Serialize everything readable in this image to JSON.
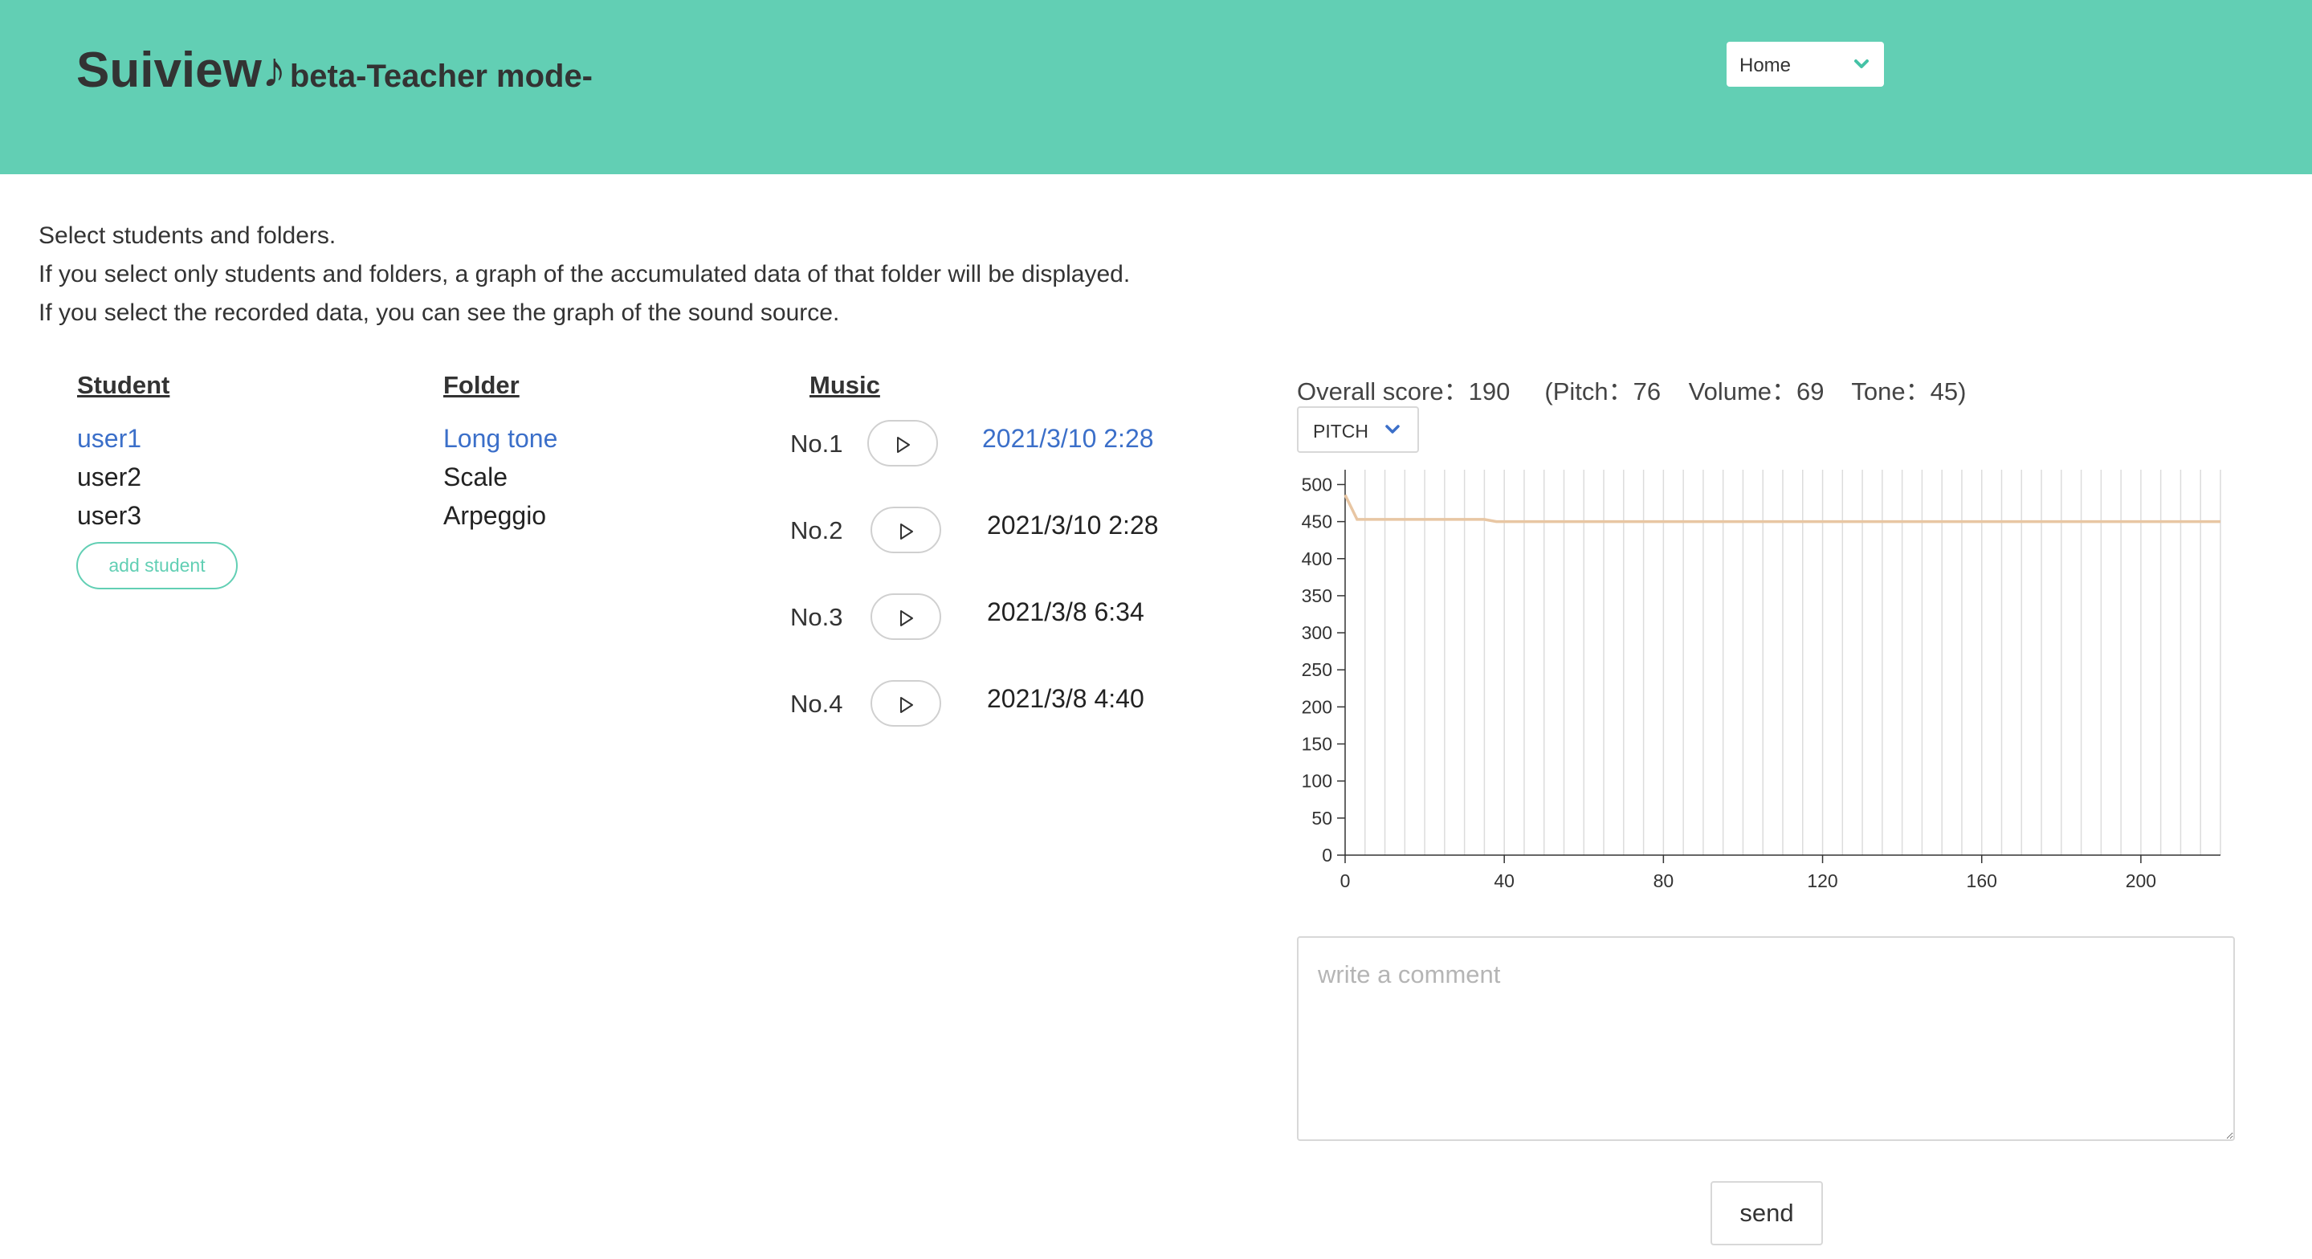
{
  "header": {
    "title": "Suiview♪",
    "subtitle": "beta-Teacher mode-",
    "nav_select": "Home"
  },
  "instructions": [
    "Select students and folders.",
    "If you select only students and folders, a graph of the accumulated data of that folder will be displayed.",
    "If you select the recorded data, you can see the graph of the sound source."
  ],
  "students": {
    "header": "Student",
    "items": [
      "user1",
      "user2",
      "user3"
    ],
    "selected_index": 0,
    "add_label": "add student"
  },
  "folders": {
    "header": "Folder",
    "items": [
      "Long tone",
      "Scale",
      "Arpeggio"
    ],
    "selected_index": 0
  },
  "music": {
    "header": "Music",
    "items": [
      {
        "no": "No.1",
        "date": "2021/3/10 2:28",
        "selected": true
      },
      {
        "no": "No.2",
        "date": "2021/3/10 2:28",
        "selected": false
      },
      {
        "no": "No.3",
        "date": "2021/3/8 6:34",
        "selected": false
      },
      {
        "no": "No.4",
        "date": "2021/3/8 4:40",
        "selected": false
      }
    ]
  },
  "score": {
    "overall": "Overall score：190",
    "pitch": "(Pitch：76",
    "volume": "Volume：69",
    "tone": "Tone：45)"
  },
  "metric_select": "PITCH",
  "chart_data": {
    "type": "line",
    "title": "",
    "xlabel": "",
    "ylabel": "",
    "xlim": [
      0,
      220
    ],
    "ylim": [
      0,
      520
    ],
    "xticks": [
      0,
      40,
      80,
      120,
      160,
      200
    ],
    "yticks": [
      0,
      50,
      100,
      150,
      200,
      250,
      300,
      350,
      400,
      450,
      500
    ],
    "grid": true,
    "series": [
      {
        "color": "#e8c6a3",
        "x": [
          0,
          3,
          35,
          38,
          220
        ],
        "y": [
          486,
          453,
          453,
          450,
          450
        ]
      }
    ]
  },
  "comment": {
    "placeholder": "write a comment",
    "value": ""
  },
  "send_label": "send",
  "colors": {
    "header_bg": "#62cfb4",
    "accent": "#62cfb4",
    "selected_text": "#3b6fc9",
    "series_line": "#e8c6a3"
  }
}
